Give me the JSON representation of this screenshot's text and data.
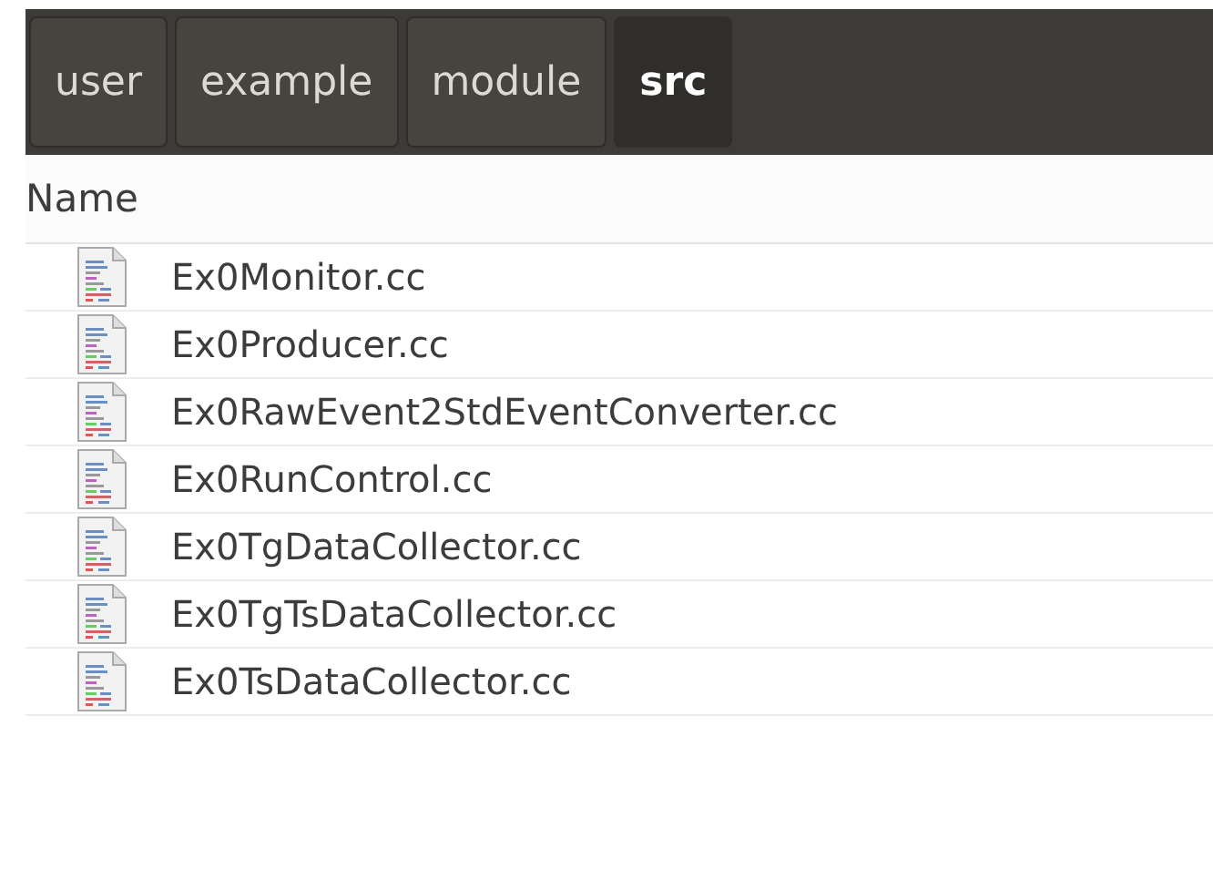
{
  "path_bar": [
    {
      "label": "user",
      "selected": false
    },
    {
      "label": "example",
      "selected": false
    },
    {
      "label": "module",
      "selected": false
    },
    {
      "label": "src",
      "selected": true
    }
  ],
  "file_list": {
    "columns": [
      "Name"
    ],
    "rows": [
      {
        "name": "Ex0Monitor.cc"
      },
      {
        "name": "Ex0Producer.cc"
      },
      {
        "name": "Ex0RawEvent2StdEventConverter.cc"
      },
      {
        "name": "Ex0RunControl.cc"
      },
      {
        "name": "Ex0TgDataCollector.cc"
      },
      {
        "name": "Ex0TgTsDataCollector.cc"
      },
      {
        "name": "Ex0TsDataCollector.cc"
      }
    ]
  }
}
